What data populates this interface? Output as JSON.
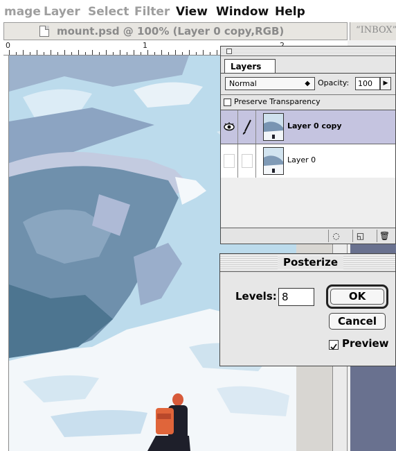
{
  "menubar": {
    "items": [
      {
        "label": "mage",
        "dimmed": true
      },
      {
        "label": "Layer",
        "dimmed": true
      },
      {
        "label": "Select",
        "dimmed": true
      },
      {
        "label": "Filter",
        "dimmed": true
      },
      {
        "label": "View",
        "dimmed": false
      },
      {
        "label": "Window",
        "dimmed": false
      },
      {
        "label": "Help",
        "dimmed": false
      }
    ]
  },
  "document": {
    "title": "mount.psd @ 100% (Layer 0 copy,RGB)",
    "ruler_labels": [
      "0",
      "1",
      "2"
    ]
  },
  "background_window": {
    "title": "“INBOX”"
  },
  "layers_palette": {
    "tab_label": "Layers",
    "blend_mode": "Normal",
    "opacity_label": "Opacity:",
    "opacity_value": "100",
    "preserve_transparency_label": "Preserve Transparency",
    "preserve_transparency_checked": false,
    "layers": [
      {
        "name": "Layer 0 copy",
        "selected": true,
        "visible": true,
        "brush": true
      },
      {
        "name": "Layer 0",
        "selected": false,
        "visible": false,
        "brush": false
      }
    ],
    "bottom_icons": [
      "layer-mask-icon",
      "new-layer-icon",
      "trash-icon"
    ]
  },
  "posterize_dialog": {
    "title": "Posterize",
    "levels_label": "Levels:",
    "levels_value": "8",
    "ok_label": "OK",
    "cancel_label": "Cancel",
    "preview_label": "Preview",
    "preview_checked": true
  },
  "colors": {
    "selection": "#c5c4e0",
    "dialog_bg": "#e7e7e7",
    "back_window": "#69718f"
  }
}
